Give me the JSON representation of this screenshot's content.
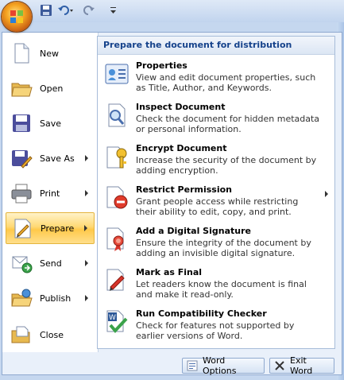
{
  "left_menu": {
    "items": [
      {
        "label": "New",
        "has_arrow": false,
        "icon": "new-document-icon"
      },
      {
        "label": "Open",
        "has_arrow": false,
        "icon": "open-folder-icon"
      },
      {
        "label": "Save",
        "has_arrow": false,
        "icon": "save-disk-icon"
      },
      {
        "label": "Save As",
        "has_arrow": true,
        "icon": "save-as-icon"
      },
      {
        "label": "Print",
        "has_arrow": true,
        "icon": "printer-icon"
      },
      {
        "label": "Prepare",
        "has_arrow": true,
        "icon": "prepare-icon",
        "selected": true
      },
      {
        "label": "Send",
        "has_arrow": true,
        "icon": "send-icon"
      },
      {
        "label": "Publish",
        "has_arrow": true,
        "icon": "publish-icon"
      },
      {
        "label": "Close",
        "has_arrow": false,
        "icon": "close-folder-icon"
      }
    ]
  },
  "panel": {
    "heading": "Prepare the document for distribution",
    "items": [
      {
        "title": "Properties",
        "desc": "View and edit document properties, such as Title, Author, and Keywords.",
        "icon": "properties-icon"
      },
      {
        "title": "Inspect Document",
        "desc": "Check the document for hidden metadata or personal information.",
        "icon": "inspect-document-icon"
      },
      {
        "title": "Encrypt Document",
        "desc": "Increase the security of the document by adding encryption.",
        "icon": "encrypt-key-icon"
      },
      {
        "title": "Restrict Permission",
        "desc": "Grant people access while restricting their ability to edit, copy, and print.",
        "icon": "restrict-permission-icon",
        "has_arrow": true
      },
      {
        "title": "Add a Digital Signature",
        "desc": "Ensure the integrity of the document by adding an invisible digital signature.",
        "icon": "digital-signature-icon"
      },
      {
        "title": "Mark as Final",
        "desc": "Let readers know the document is final and make it read-only.",
        "icon": "mark-final-icon"
      },
      {
        "title": "Run Compatibility Checker",
        "desc": "Check for features not supported by earlier versions of Word.",
        "icon": "compatibility-checker-icon"
      }
    ]
  },
  "buttons": {
    "options": "Word Options",
    "exit": "Exit Word"
  },
  "colors": {
    "accent": "#15428b",
    "selected": "#ffd975"
  }
}
